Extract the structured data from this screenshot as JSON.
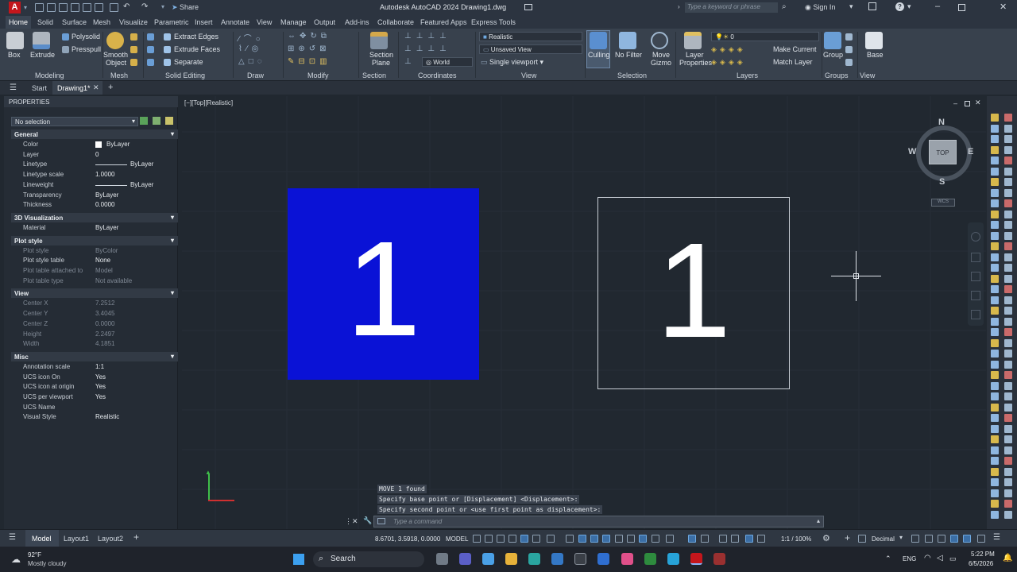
{
  "app": {
    "title": "Autodesk AutoCAD 2024   Drawing1.dwg",
    "share": "Share",
    "search_placeholder": "Type a keyword or phrase",
    "sign_in": "Sign In"
  },
  "ribbon_tabs": [
    "Home",
    "Solid",
    "Surface",
    "Mesh",
    "Visualize",
    "Parametric",
    "Insert",
    "Annotate",
    "View",
    "Manage",
    "Output",
    "Add-ins",
    "Collaborate",
    "Featured Apps",
    "Express Tools"
  ],
  "ribbon": {
    "modeling": {
      "box": "Box",
      "extrude": "Extrude",
      "polysolid": "Polysolid",
      "presspull": "Presspull",
      "label": "Modeling"
    },
    "mesh": {
      "smooth": "Smooth",
      "object": "Object",
      "label": "Mesh"
    },
    "solid_editing": {
      "extract_edges": "Extract Edges",
      "extrude_faces": "Extrude Faces",
      "separate": "Separate",
      "label": "Solid Editing"
    },
    "draw_label": "Draw",
    "modify_label": "Modify",
    "section": {
      "plane": "Section",
      "plane2": "Plane",
      "label": "Section"
    },
    "coordinates": {
      "world": "World",
      "label": "Coordinates"
    },
    "view": {
      "style": "Realistic",
      "unsaved": "Unsaved View",
      "single": "Single viewport",
      "label": "View"
    },
    "selection": {
      "culling": "Culling",
      "no_filter": "No Filter",
      "move": "Move",
      "gizmo": "Gizmo",
      "label": "Selection"
    },
    "layers": {
      "layer": "Layer",
      "properties": "Properties",
      "current_layer": "0",
      "make_current": "Make Current",
      "match_layer": "Match Layer",
      "label": "Layers"
    },
    "groups": {
      "group": "Group",
      "label": "Groups"
    },
    "view2": {
      "base": "Base",
      "label": "View"
    }
  },
  "file_tabs": {
    "start": "Start",
    "drawing": "Drawing1*"
  },
  "properties": {
    "header": "PROPERTIES",
    "selection": "No selection",
    "general": {
      "title": "General",
      "rows": [
        {
          "k": "Color",
          "v": "ByLayer"
        },
        {
          "k": "Layer",
          "v": "0"
        },
        {
          "k": "Linetype",
          "v": "ByLayer"
        },
        {
          "k": "Linetype scale",
          "v": "1.0000"
        },
        {
          "k": "Lineweight",
          "v": "ByLayer"
        },
        {
          "k": "Transparency",
          "v": "ByLayer"
        },
        {
          "k": "Thickness",
          "v": "0.0000"
        }
      ]
    },
    "viz": {
      "title": "3D Visualization",
      "rows": [
        {
          "k": "Material",
          "v": "ByLayer"
        }
      ]
    },
    "plot": {
      "title": "Plot style",
      "rows": [
        {
          "k": "Plot style",
          "v": "ByColor"
        },
        {
          "k": "Plot style table",
          "v": "None"
        },
        {
          "k": "Plot table attached to",
          "v": "Model"
        },
        {
          "k": "Plot table type",
          "v": "Not available"
        }
      ]
    },
    "view": {
      "title": "View",
      "rows": [
        {
          "k": "Center X",
          "v": "7.2512"
        },
        {
          "k": "Center Y",
          "v": "3.4045"
        },
        {
          "k": "Center Z",
          "v": "0.0000"
        },
        {
          "k": "Height",
          "v": "2.2497"
        },
        {
          "k": "Width",
          "v": "4.1851"
        }
      ]
    },
    "misc": {
      "title": "Misc",
      "rows": [
        {
          "k": "Annotation scale",
          "v": "1:1"
        },
        {
          "k": "UCS icon On",
          "v": "Yes"
        },
        {
          "k": "UCS icon at origin",
          "v": "Yes"
        },
        {
          "k": "UCS per viewport",
          "v": "Yes"
        },
        {
          "k": "UCS Name",
          "v": ""
        },
        {
          "k": "Visual Style",
          "v": "Realistic"
        }
      ]
    }
  },
  "viewport": {
    "label": "[−][Top][Realistic]",
    "left_number": "1",
    "right_number": "1",
    "viewcube": {
      "top": "TOP",
      "n": "N",
      "s": "S",
      "e": "E",
      "w": "W",
      "wcs": "WCS"
    }
  },
  "command": {
    "history": [
      "MOVE 1 found",
      "Specify base point or [Displacement] <Displacement>:",
      "Specify second point or <use first point as displacement>:"
    ],
    "placeholder": "Type a command"
  },
  "status": {
    "model": "Model",
    "layout1": "Layout1",
    "layout2": "Layout2",
    "coords": "8.6701, 3.5918, 0.0000",
    "mode": "MODEL",
    "scale": "1:1 / 100%",
    "units": "Decimal"
  },
  "taskbar": {
    "weather_temp": "92°F",
    "weather_desc": "Mostly cloudy",
    "search": "Search",
    "lang": "ENG",
    "time": "5:22 PM",
    "date": "6/5/2026"
  },
  "colors": {
    "accent": "#0a12d6",
    "app_red": "#c4161c"
  }
}
